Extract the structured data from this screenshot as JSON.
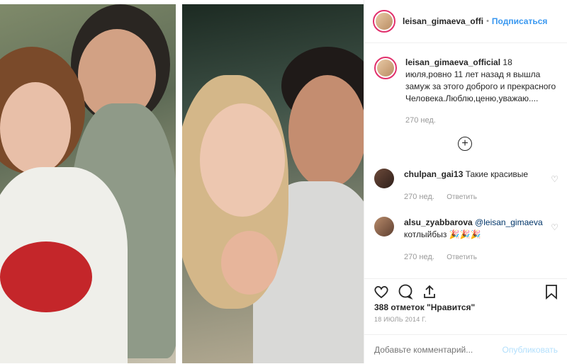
{
  "post": {
    "username": "leisan_gimaeva_offi",
    "follow_label": "Подписаться",
    "separator": "•"
  },
  "caption": {
    "username": "leisan_gimaeva_official",
    "text": " 18 июля,ровно 11 лет назад я вышла замуж за этого доброго и прекрасного Человека.Люблю,ценю,уважаю....",
    "time": "270 нед."
  },
  "comments": [
    {
      "username": "chulpan_gai13",
      "text": " Такие красивые",
      "time": "270 нед.",
      "reply": "Ответить"
    },
    {
      "username": "alsu_zyabbarova",
      "mention": " @leisan_gimaeva",
      "text": "котлыйбыз 🎉🎉🎉",
      "time": "270 нед.",
      "reply": "Ответить"
    }
  ],
  "likes_text": "388 отметок \"Нравится\"",
  "date_text": "18 ИЮЛЬ 2014 Г.",
  "comment_input": {
    "placeholder": "Добавьте комментарий...",
    "publish_label": "Опубликовать"
  },
  "icons": [
    "heart-icon",
    "comment-icon",
    "share-icon",
    "bookmark-icon",
    "plus-circle-icon"
  ],
  "colors": {
    "link": "#3897f0",
    "muted": "#999999",
    "story_ring": "#e1306c"
  }
}
